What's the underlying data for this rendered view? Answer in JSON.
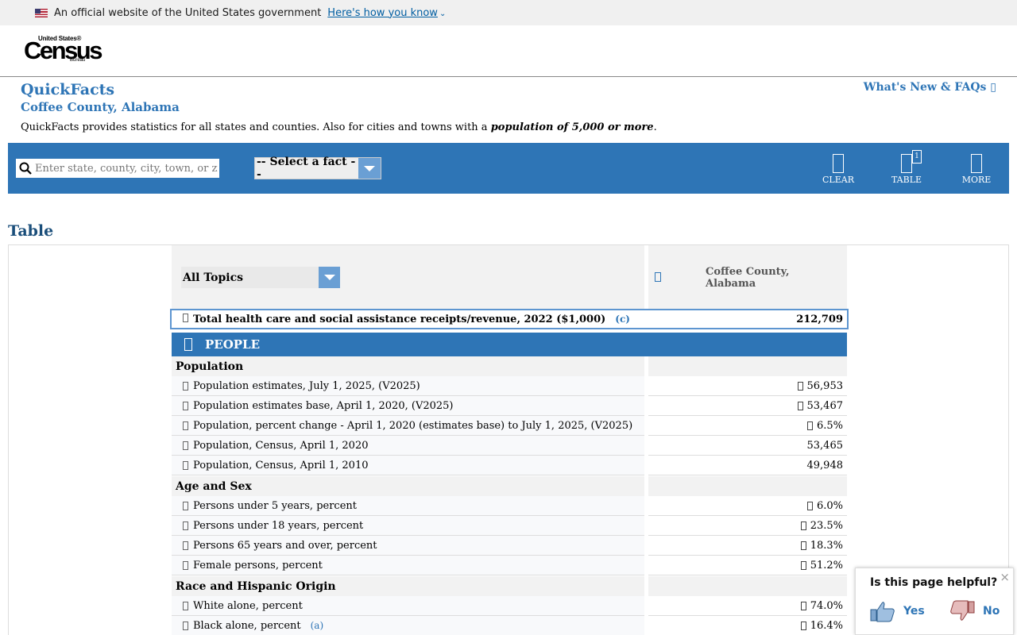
{
  "gov_banner": {
    "text": "An official website of the United States government",
    "link": "Here's how you know"
  },
  "logo": {
    "line1": "United States®",
    "line2": "Census",
    "line3": "Bureau"
  },
  "header": {
    "title": "QuickFacts",
    "subtitle": "Coffee County, Alabama",
    "whats_new": "What's New & FAQs",
    "description_prefix": "QuickFacts provides statistics for all states and counties. Also for cities and towns with a",
    "description_emphasis": "population of 5,000 or more",
    "description_suffix": "."
  },
  "toolbar": {
    "search_placeholder": "Enter state, county, city, town, or zip code",
    "fact_select": "-- Select a fact --",
    "clear_label": "CLEAR",
    "table_label": "TABLE",
    "table_badge": "1",
    "more_label": "MORE"
  },
  "table": {
    "heading": "Table",
    "topics_select": "All Topics",
    "column_geo": "Coffee County, Alabama",
    "highlight": {
      "label": "Total health care and social assistance receipts/revenue, 2022 ($1,000)",
      "note": "(c)",
      "value": "212,709"
    },
    "section": "PEOPLE",
    "groups": [
      {
        "title": "Population",
        "rows": [
          {
            "label": "Population estimates, July 1, 2025, (V2025)",
            "value": "56,953"
          },
          {
            "label": "Population estimates base, April 1, 2020, (V2025)",
            "value": "53,467"
          },
          {
            "label": "Population, percent change - April 1, 2020 (estimates base) to July 1, 2025, (V2025)",
            "value": "6.5%"
          },
          {
            "label": "Population, Census, April 1, 2020",
            "value": "53,465"
          },
          {
            "label": "Population, Census, April 1, 2010",
            "value": "49,948"
          }
        ]
      },
      {
        "title": "Age and Sex",
        "rows": [
          {
            "label": "Persons under 5 years, percent",
            "value": "6.0%"
          },
          {
            "label": "Persons under 18 years, percent",
            "value": "23.5%"
          },
          {
            "label": "Persons 65 years and over, percent",
            "value": "18.3%"
          },
          {
            "label": "Female persons, percent",
            "value": "51.2%"
          }
        ]
      },
      {
        "title": "Race and Hispanic Origin",
        "rows": [
          {
            "label": "White alone, percent",
            "value": "74.0%"
          },
          {
            "label": "Black alone, percent",
            "note": "(a)",
            "value": "16.4%"
          }
        ]
      }
    ]
  },
  "feedback": {
    "question": "Is this page helpful?",
    "yes": "Yes",
    "no": "No",
    "close": "×"
  }
}
